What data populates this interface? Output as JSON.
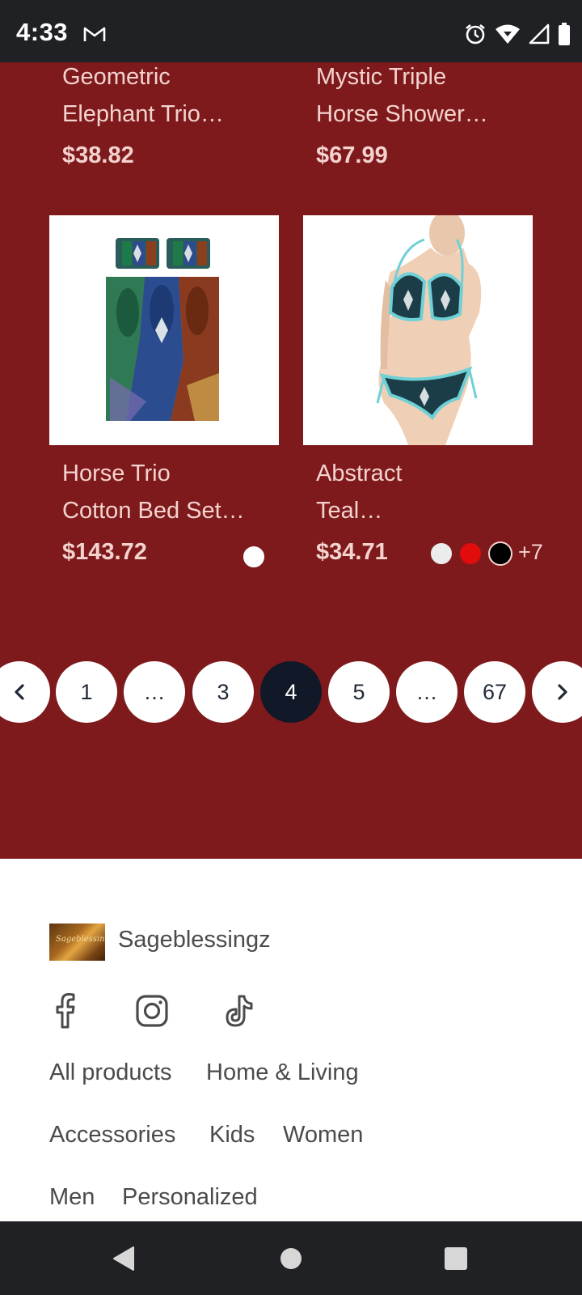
{
  "status_bar": {
    "time": "4:33",
    "icons": [
      "gmail-icon",
      "alarm-icon",
      "wifi-icon",
      "signal-icon",
      "battery-icon"
    ]
  },
  "products": [
    {
      "title_line1": "Geometric",
      "title_line2": "Elephant Trio…",
      "price": "$38.82"
    },
    {
      "title_line1": "Mystic Triple",
      "title_line2": "Horse Shower…",
      "price": "$67.99"
    },
    {
      "title_line1": "Horse Trio",
      "title_line2": "Cotton Bed Set…",
      "price": "$143.72",
      "swatches": [
        "#ffffff"
      ]
    },
    {
      "title_line1": "Abstract",
      "title_line2": "Teal…",
      "price": "$34.71",
      "swatches": [
        "#ececec",
        "#e10c0c",
        "#000000"
      ],
      "more_colors": "+7"
    }
  ],
  "pagination": {
    "prev_icon": "chevron-left-icon",
    "next_icon": "chevron-right-icon",
    "pages": [
      "1",
      "…",
      "3",
      "4",
      "5",
      "…",
      "67"
    ],
    "current": "4"
  },
  "footer": {
    "brand_name": "Sageblessingz",
    "logo_text": "Sageblessingz",
    "social_icons": [
      "facebook-icon",
      "instagram-icon",
      "tiktok-icon"
    ],
    "links": [
      "All products",
      "Home & Living",
      "Accessories",
      "Kids",
      "Women",
      "Men",
      "Personalized"
    ]
  },
  "colors": {
    "section_background": "#7e1a1c",
    "text_on_red": "#f4d3cf",
    "active_page": "#111827",
    "system_bar": "#202124"
  }
}
